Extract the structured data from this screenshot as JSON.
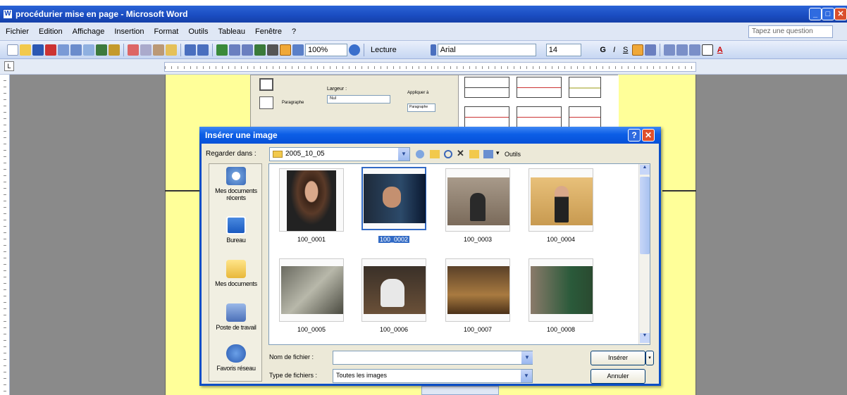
{
  "window": {
    "title": "procédurier mise en page - Microsoft Word"
  },
  "menu": {
    "items": [
      "Fichier",
      "Edition",
      "Affichage",
      "Insertion",
      "Format",
      "Outils",
      "Tableau",
      "Fenêtre",
      "?"
    ],
    "question_box": "Tapez une question"
  },
  "toolbar": {
    "zoom": "100%",
    "reading": "Lecture",
    "font": "Arial",
    "size": "14"
  },
  "embedded": {
    "label_largeur": "Largeur :",
    "value_null": "Nul",
    "label_appliquer": "Appliquer à",
    "value_paragraphe": "Paragraphe",
    "label_paragraphe_btn": "Paragraphe"
  },
  "dialog": {
    "title": "Insérer une image",
    "look_in_label": "Regarder dans :",
    "look_in_value": "2005_10_05",
    "tools_label": "Outils",
    "places": [
      {
        "label": "Mes documents récents",
        "icon": "recent-documents-icon"
      },
      {
        "label": "Bureau",
        "icon": "desktop-icon"
      },
      {
        "label": "Mes documents",
        "icon": "my-documents-icon"
      },
      {
        "label": "Poste de travail",
        "icon": "my-computer-icon"
      },
      {
        "label": "Favoris réseau",
        "icon": "network-places-icon"
      }
    ],
    "files": [
      {
        "name": "100_0001",
        "selected": false
      },
      {
        "name": "100_0002",
        "selected": true
      },
      {
        "name": "100_0003",
        "selected": false
      },
      {
        "name": "100_0004",
        "selected": false
      },
      {
        "name": "100_0005",
        "selected": false
      },
      {
        "name": "100_0006",
        "selected": false
      },
      {
        "name": "100_0007",
        "selected": false
      },
      {
        "name": "100_0008",
        "selected": false
      }
    ],
    "filename_label": "Nom de fichier :",
    "filename_value": "",
    "filetype_label": "Type de fichiers :",
    "filetype_value": "Toutes les images",
    "insert_button": "Insérer",
    "cancel_button": "Annuler"
  },
  "colors": {
    "title_blue": "#0c5ee6",
    "page_yellow": "#ffff99",
    "selection": "#316ac5"
  }
}
